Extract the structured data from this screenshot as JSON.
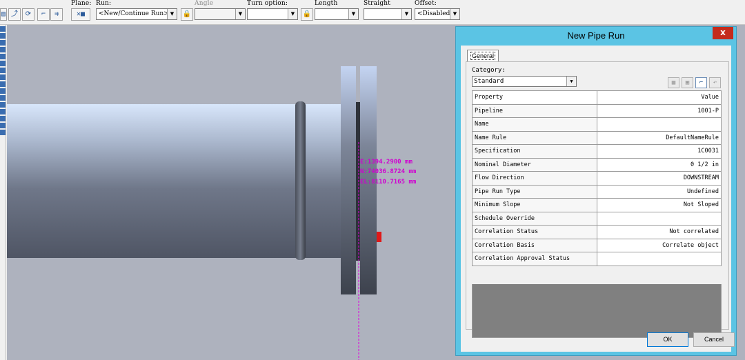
{
  "ribbon": {
    "plane_label": "Plane:",
    "run_label": "Run:",
    "run_value": "<New/Continue Run>",
    "angle_label": "Angle",
    "turn_option_label": "Turn option:",
    "length_label": "Length",
    "straight_label": "Straight",
    "offset_label": "Offset:",
    "offset_value": "<Disabled>"
  },
  "viewport": {
    "coord_e": "E:1394.2900 mm",
    "coord_n": "N:74036.8724 mm",
    "coord_el": "EL:8110.7165 mm"
  },
  "dialog": {
    "title": "New Pipe Run",
    "close_glyph": "x",
    "tab_label": "General",
    "category_label": "Category:",
    "category_value": "Standard",
    "grid_header": {
      "property": "Property",
      "value": "Value"
    },
    "rows": [
      {
        "property": "Pipeline",
        "value": "1001-P"
      },
      {
        "property": "Name",
        "value": ""
      },
      {
        "property": "Name Rule",
        "value": "DefaultNameRule"
      },
      {
        "property": "Specification",
        "value": "1C0031"
      },
      {
        "property": "Nominal Diameter",
        "value": "0 1/2 in"
      },
      {
        "property": "Flow Direction",
        "value": "DOWNSTREAM"
      },
      {
        "property": "Pipe Run Type",
        "value": "Undefined"
      },
      {
        "property": "Minimum Slope",
        "value": "Not Sloped"
      },
      {
        "property": "Schedule Override",
        "value": ""
      },
      {
        "property": "Correlation Status",
        "value": "Not correlated"
      },
      {
        "property": "Correlation Basis",
        "value": "Correlate object"
      },
      {
        "property": "Correlation Approval Status",
        "value": ""
      }
    ],
    "ok_label": "OK",
    "cancel_label": "Cancel"
  },
  "colors": {
    "dialog_frame": "#5bc4e4",
    "close_button": "#c42b1c",
    "coordinate_text": "#d000d0",
    "viewport_background": "#aeb2be"
  }
}
